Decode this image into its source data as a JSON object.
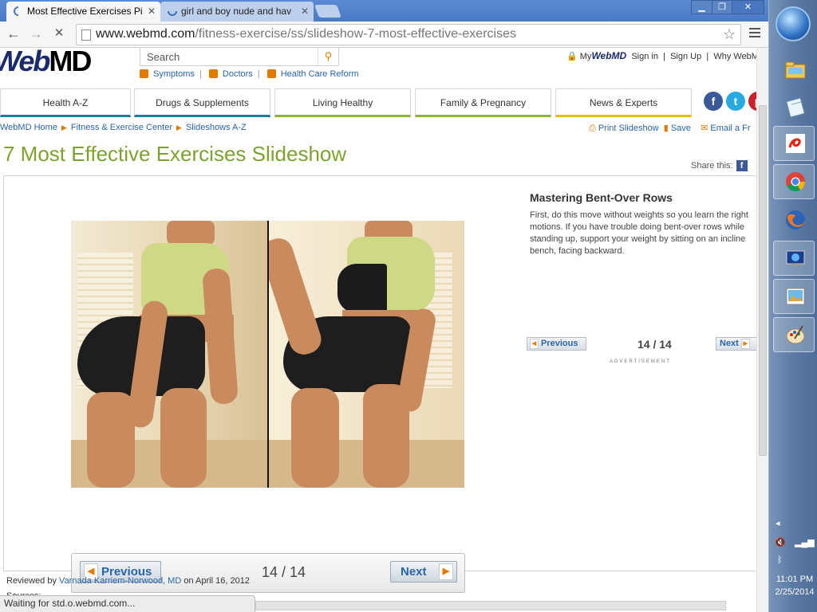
{
  "browser": {
    "tabs": [
      {
        "title": "Most Effective Exercises Pi",
        "active": true
      },
      {
        "title": "girl and boy nude and hav",
        "active": false
      }
    ],
    "url_host": "www.webmd.com",
    "url_path": "/fitness-exercise/ss/slideshow-7-most-effective-exercises",
    "status_text": "Waiting for std.o.webmd.com..."
  },
  "header": {
    "logo": "WebMD",
    "search_placeholder": "Search",
    "quick_links": [
      "Symptoms",
      "Doctors",
      "Health Care Reform"
    ],
    "my_label": "My",
    "my_brand": "WebMD",
    "sign_in": "Sign in",
    "sign_up": "Sign Up",
    "why": "Why WebM"
  },
  "nav": {
    "tabs": [
      "Health A-Z",
      "Drugs & Supplements",
      "Living Healthy",
      "Family & Pregnancy",
      "News & Experts"
    ],
    "tab_colors": [
      "#1f7a9b",
      "#1f7a9b",
      "#8fb33a",
      "#8fb33a",
      "#f3b600"
    ]
  },
  "breadcrumb": [
    "WebMD Home",
    "Fitness & Exercise Center",
    "Slideshows A-Z"
  ],
  "tools": {
    "print": "Print Slideshow",
    "save": "Save",
    "email": "Email a Fr"
  },
  "page": {
    "title": "7 Most Effective Exercises Slideshow",
    "share_label": "Share this:"
  },
  "slide": {
    "heading": "Mastering Bent-Over Rows",
    "body": "First, do this move without weights so you learn the right motions. If you have trouble doing bent-over rows while standing up, support your weight by sitting on an incline bench, facing backward.",
    "prev_label": "Previous",
    "next_label": "Next",
    "counter": "14 / 14",
    "current": 14,
    "total": 14,
    "ad_label": "ADVERTISEMENT"
  },
  "footer": {
    "reviewed_prefix": "Reviewed by",
    "reviewer": "Varnada Karriem-Norwood, MD",
    "reviewed_suffix": "on April 16, 2012",
    "sources": "Sources:"
  },
  "taskbar": {
    "time": "11:01 PM",
    "date": "2/25/2014",
    "pinned": [
      "explorer-icon",
      "notepad-icon",
      "airtel-icon",
      "chrome-icon",
      "firefox-icon",
      "remote-desktop-icon",
      "photo-viewer-icon",
      "paint-icon"
    ]
  }
}
